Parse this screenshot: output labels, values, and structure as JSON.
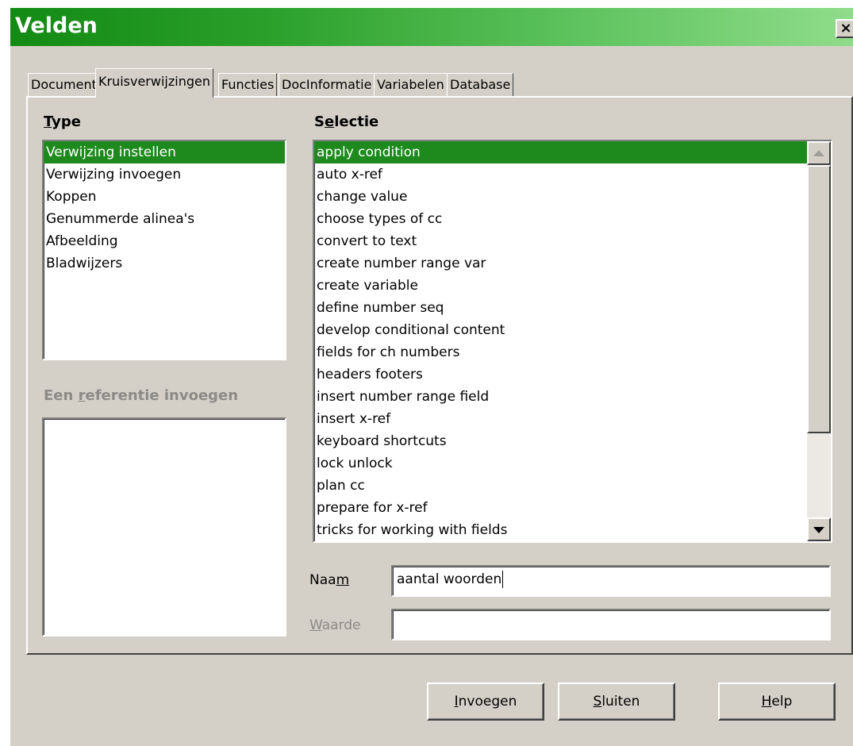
{
  "window": {
    "title": "Velden",
    "close_glyph": "×"
  },
  "tabs": [
    {
      "label": "Document"
    },
    {
      "label": "Kruisverwijzingen"
    },
    {
      "label": "Functies"
    },
    {
      "label": "DocInformatie"
    },
    {
      "label": "Variabelen"
    },
    {
      "label": "Database"
    }
  ],
  "active_tab": "Kruisverwijzingen",
  "type_section": {
    "heading_first": "T",
    "heading_rest": "ype",
    "items": [
      "Verwijzing instellen",
      "Verwijzing invoegen",
      "Koppen",
      "Genummerde alinea's",
      "Afbeelding",
      "Bladwijzers"
    ],
    "selected": "Verwijzing instellen"
  },
  "reference_section": {
    "heading_pre": "Een ",
    "heading_ul": "r",
    "heading_post": "eferentie invoegen"
  },
  "selection_section": {
    "heading_pre": "S",
    "heading_ul": "e",
    "heading_post": "lectie",
    "items": [
      "apply condition",
      "auto x-ref",
      "change value",
      "choose types of cc",
      "convert to text",
      "create number range var",
      "create variable",
      "define number seq",
      "develop conditional content",
      "fields for ch numbers",
      "headers footers",
      "insert number range field",
      "insert x-ref",
      "keyboard shortcuts",
      "lock unlock",
      "plan cc",
      "prepare for x-ref",
      "tricks for working with fields"
    ],
    "selected": "apply condition"
  },
  "name_field": {
    "label_pre": "Naa",
    "label_ul": "m",
    "value": "aantal woorden"
  },
  "value_field": {
    "label_ul": "W",
    "label_post": "aarde",
    "value": ""
  },
  "buttons": {
    "insert": {
      "ul": "I",
      "rest": "nvoegen"
    },
    "close": {
      "ul": "S",
      "rest": "luiten"
    },
    "help": {
      "ul": "H",
      "rest": "elp"
    }
  },
  "colors": {
    "title_gradient_start": "#138a13",
    "title_gradient_end": "#8fdc8a",
    "selection": "#1e8a1e",
    "dialog_face": "#d4d0c8"
  },
  "icons": {
    "scroll_up": "triangle-up-icon",
    "scroll_down": "triangle-down-icon",
    "close": "close-icon"
  }
}
